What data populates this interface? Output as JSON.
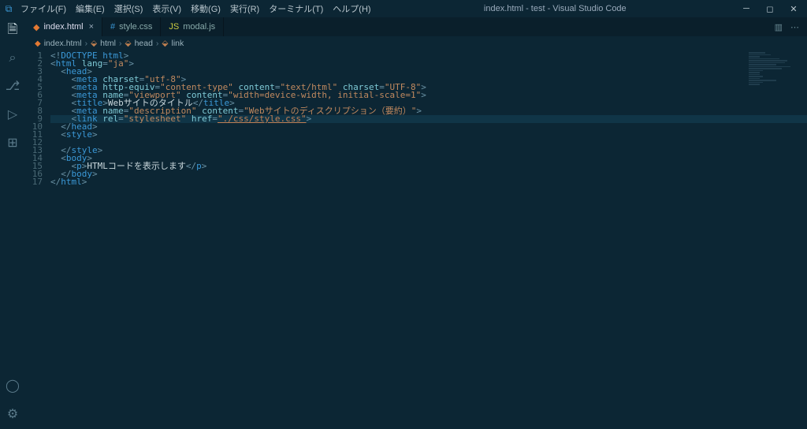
{
  "menus": [
    "ファイル(F)",
    "編集(E)",
    "選択(S)",
    "表示(V)",
    "移動(G)",
    "実行(R)",
    "ターミナル(T)",
    "ヘルプ(H)"
  ],
  "windowTitle": "index.html - test - Visual Studio Code",
  "tabs": [
    {
      "icon": "html",
      "label": "index.html",
      "active": true,
      "dirty": false
    },
    {
      "icon": "css",
      "label": "style.css",
      "active": false,
      "dirty": false
    },
    {
      "icon": "js",
      "label": "modal.js",
      "active": false,
      "dirty": false
    }
  ],
  "breadcrumbs": [
    {
      "icon": "html",
      "label": "index.html"
    },
    {
      "icon": "el",
      "label": "html"
    },
    {
      "icon": "el",
      "label": "head"
    },
    {
      "icon": "el",
      "label": "link"
    }
  ],
  "lineCount": 17,
  "activityIcons": [
    "files-icon",
    "search-icon",
    "source-control-icon",
    "run-icon",
    "extensions-icon"
  ],
  "bottomIcons": [
    "account-icon",
    "gear-icon"
  ],
  "code": {
    "l1": "<!DOCTYPE html>",
    "l2_attr": "lang",
    "l2_val": "\"ja\"",
    "l4_attr": "charset",
    "l4_val": "\"utf-8\"",
    "l5_a1": "http-equiv",
    "l5_v1": "\"content-type\"",
    "l5_a2": "content",
    "l5_v2": "\"text/html\"",
    "l5_a3": "charset",
    "l5_v3": "\"UTF-8\"",
    "l6_a1": "name",
    "l6_v1": "\"viewport\"",
    "l6_a2": "content",
    "l6_v2": "\"width=device-width, initial-scale=1\"",
    "l7_txt": "Webサイトのタイトル",
    "l8_a1": "name",
    "l8_v1": "\"description\"",
    "l8_a2": "content",
    "l8_v2": "\"Webサイトのディスクリプション（要約）\"",
    "l9_a1": "rel",
    "l9_v1": "\"stylesheet\"",
    "l9_a2": "href",
    "l9_v2": "\"./css/style.css\"",
    "l15_txt": "HTMLコードを表示します"
  }
}
